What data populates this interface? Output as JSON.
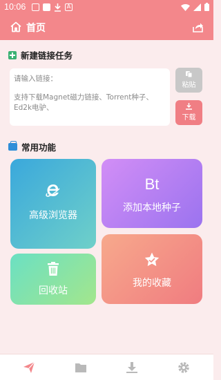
{
  "status_bar": {
    "time": "10:06",
    "left_icons": [
      "image-icon",
      "image-icon",
      "download-icon",
      "a-icon"
    ],
    "right_icons": [
      "wifi-icon",
      "signal-icon",
      "battery-icon"
    ]
  },
  "app_bar": {
    "title": "首页",
    "left_icon": "home-icon",
    "right_icon": "share-icon",
    "color": "#f3878b"
  },
  "new_task": {
    "title": "新建链接任务",
    "icon": "plus-square-icon",
    "placeholder_line1": "请输入链接：",
    "placeholder_line2": "支持下载Magnet磁力链接、Torrent种子、Ed2k电驴、",
    "paste_label": "粘贴",
    "download_label": "下载"
  },
  "features": {
    "title": "常用功能",
    "icon": "briefcase-icon",
    "items": [
      {
        "label": "高级浏览器",
        "icon": "browser-e-icon"
      },
      {
        "label": "添加本地种子",
        "icon": "bt-icon",
        "icon_text": "Bt"
      },
      {
        "label": "回收站",
        "icon": "trash-icon"
      },
      {
        "label": "我的收藏",
        "icon": "star-icon"
      }
    ]
  },
  "bottom_nav": {
    "items": [
      {
        "name": "send-icon",
        "active": true
      },
      {
        "name": "folder-icon",
        "active": false
      },
      {
        "name": "download-icon",
        "active": false
      },
      {
        "name": "gear-icon",
        "active": false
      }
    ],
    "active_color": "#f3878b",
    "inactive_color": "#b9b9b9"
  }
}
